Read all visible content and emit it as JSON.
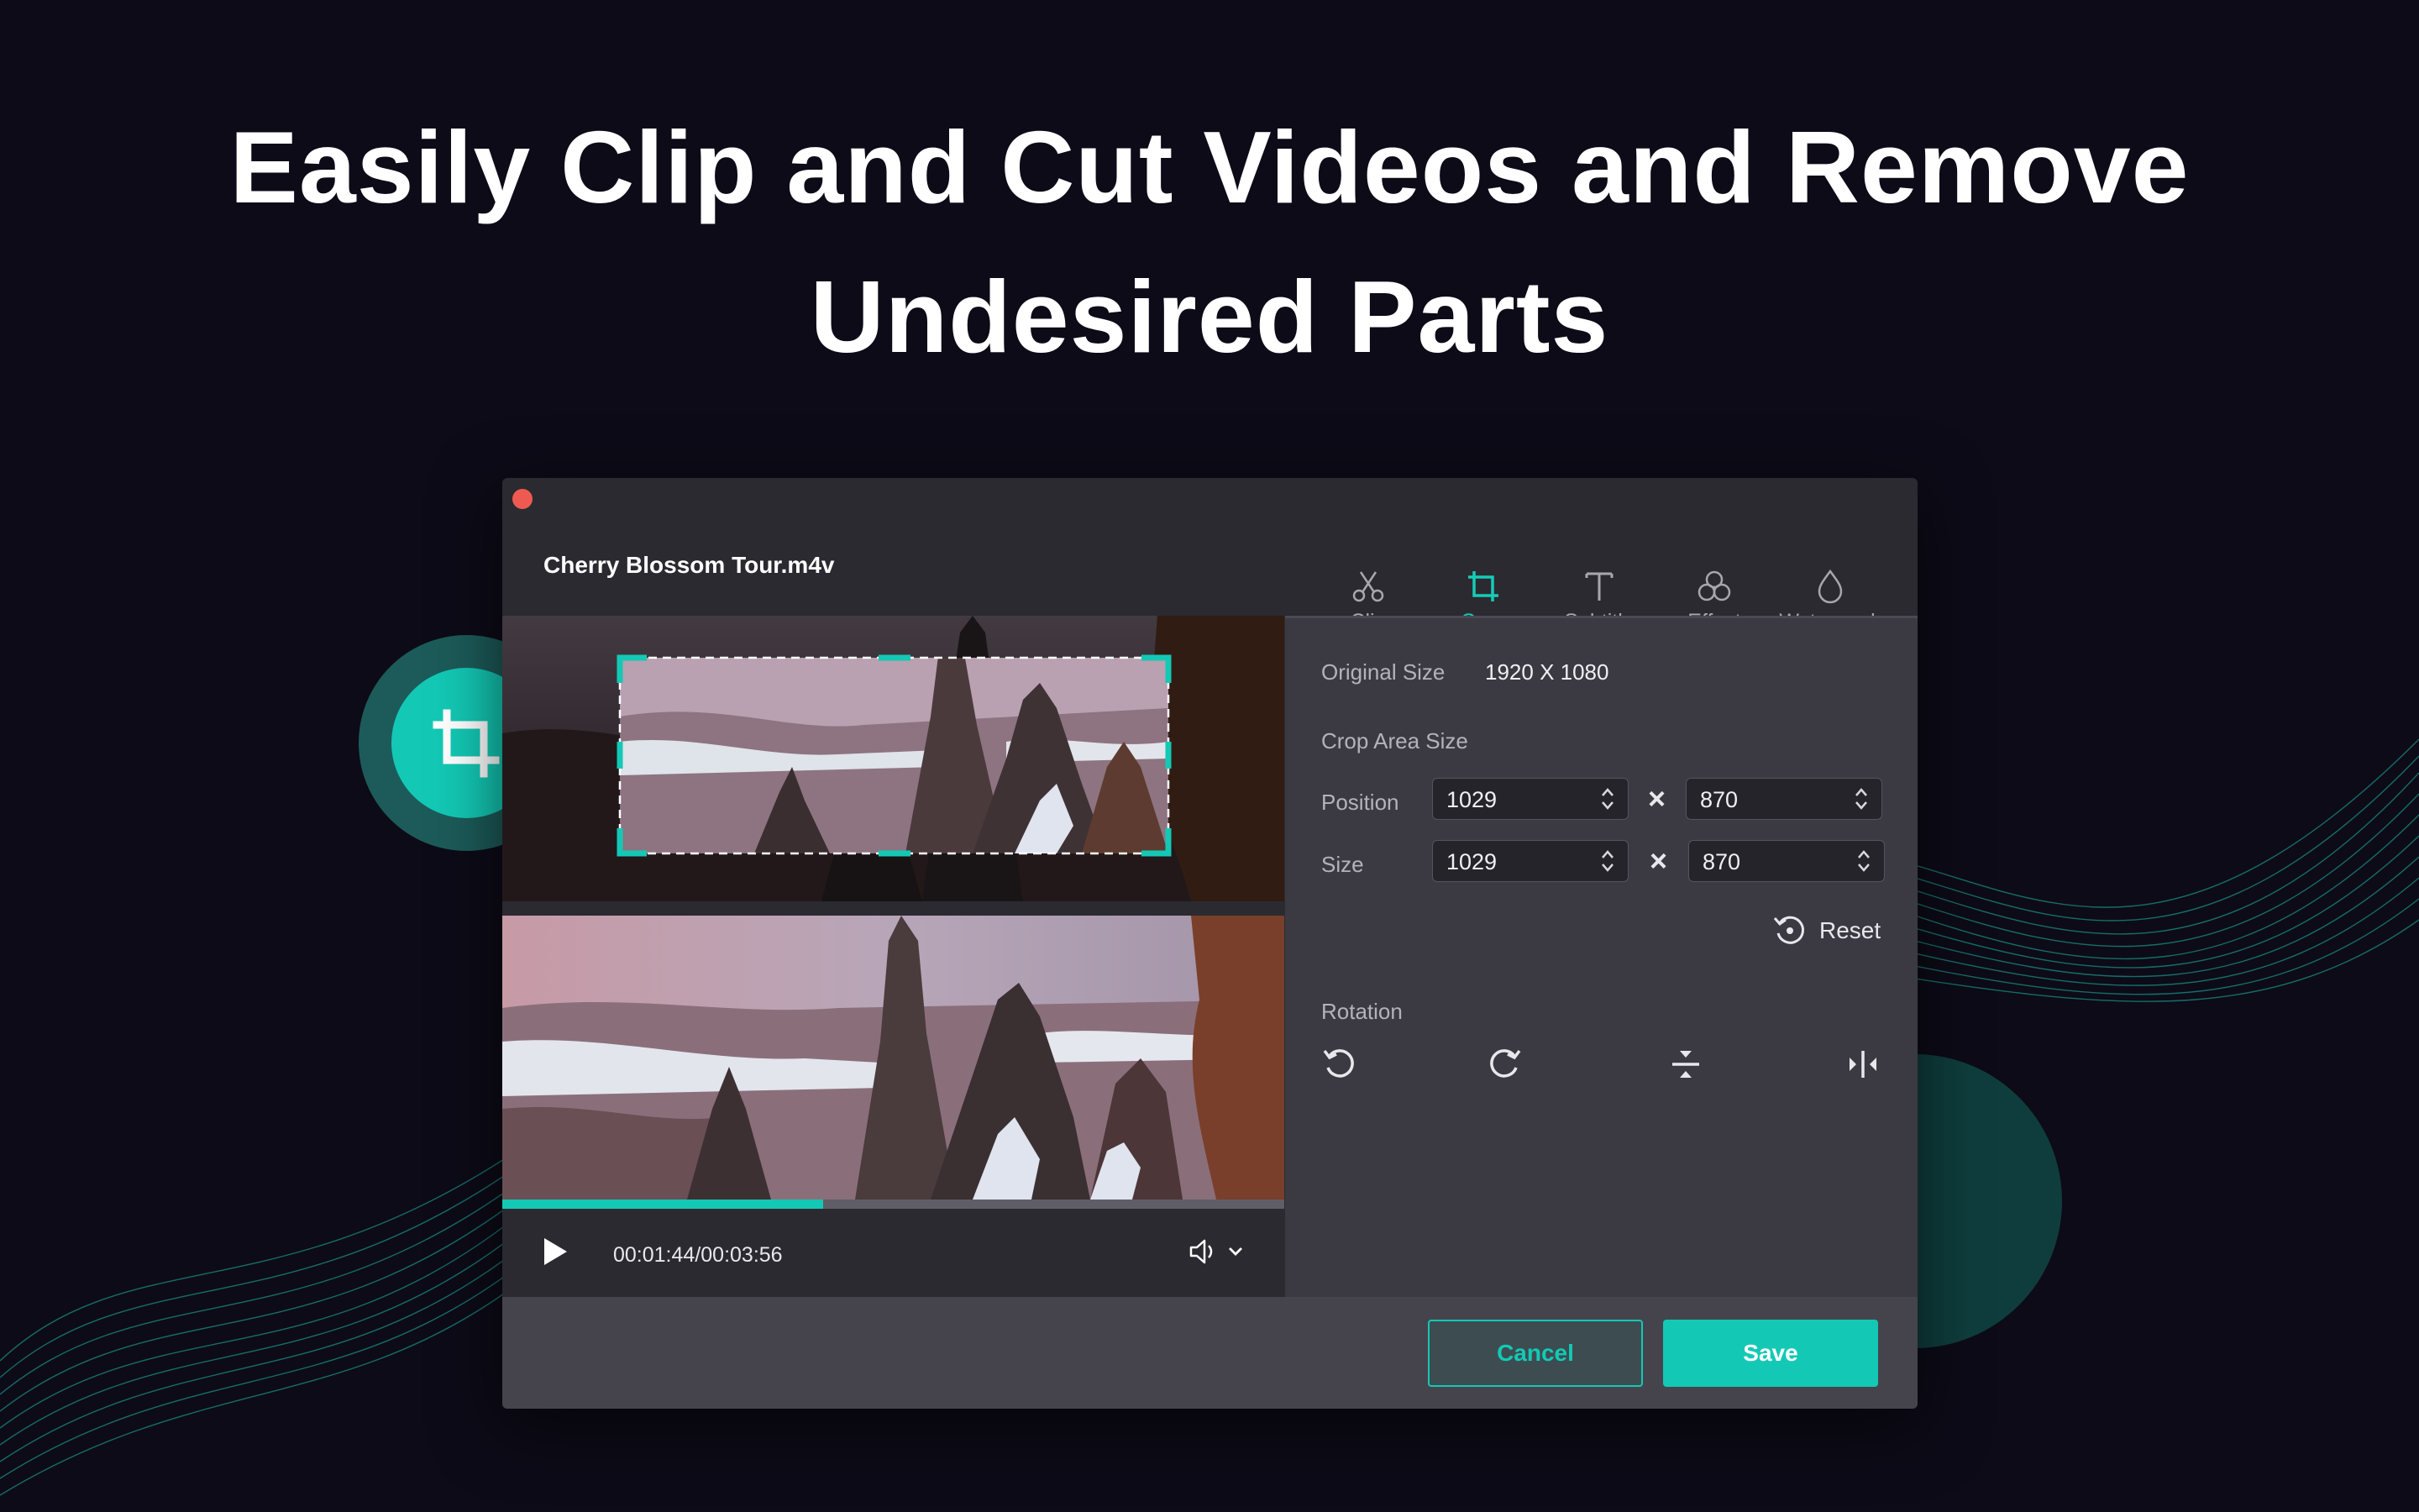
{
  "headline": {
    "line1": "Easily Clip and Cut Videos and Remove",
    "line2": "Undesired Parts"
  },
  "window": {
    "file_name": "Cherry Blossom Tour.m4v",
    "tabs": [
      {
        "label": "Clip",
        "icon": "scissors-icon"
      },
      {
        "label": "Crop",
        "icon": "crop-icon",
        "active": true
      },
      {
        "label": "Subtitle",
        "icon": "text-icon"
      },
      {
        "label": "Effect",
        "icon": "effect-icon"
      },
      {
        "label": "Watermark",
        "icon": "droplet-icon"
      }
    ]
  },
  "crop_panel": {
    "original_size_label": "Original Size",
    "original_size_value": "1920 X 1080",
    "crop_area_label": "Crop Area Size",
    "position_label": "Position",
    "position_x": "1029",
    "position_y": "870",
    "size_label": "Size",
    "size_w": "1029",
    "size_h": "870",
    "times_symbol": "×",
    "reset_label": "Reset",
    "rotation_label": "Rotation"
  },
  "player": {
    "time": "00:01:44/00:03:56",
    "progress": 0.41
  },
  "footer": {
    "cancel_label": "Cancel",
    "save_label": "Save"
  },
  "colors": {
    "accent": "#13c9b5",
    "background": "#0d0b17",
    "window": "#2b2a31",
    "panel": "#3b3a43",
    "close": "#ee5a52"
  }
}
